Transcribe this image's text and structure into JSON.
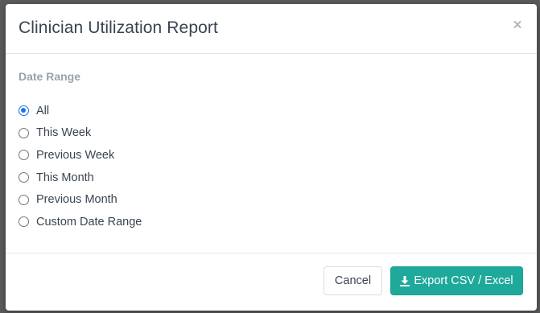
{
  "modal": {
    "title": "Clinician Utilization Report",
    "close_symbol": "×"
  },
  "date_range": {
    "label": "Date Range",
    "selected": "All",
    "options": [
      {
        "label": "All",
        "checked": true
      },
      {
        "label": "This Week",
        "checked": false
      },
      {
        "label": "Previous Week",
        "checked": false
      },
      {
        "label": "This Month",
        "checked": false
      },
      {
        "label": "Previous Month",
        "checked": false
      },
      {
        "label": "Custom Date Range",
        "checked": false
      }
    ]
  },
  "footer": {
    "cancel_label": "Cancel",
    "export_label": "Export CSV / Excel",
    "export_icon": "download-icon"
  },
  "colors": {
    "accent": "#1fa99b",
    "radio_selected": "#1a73e8",
    "title_text": "#3a4450",
    "section_label": "#97a3ad"
  }
}
